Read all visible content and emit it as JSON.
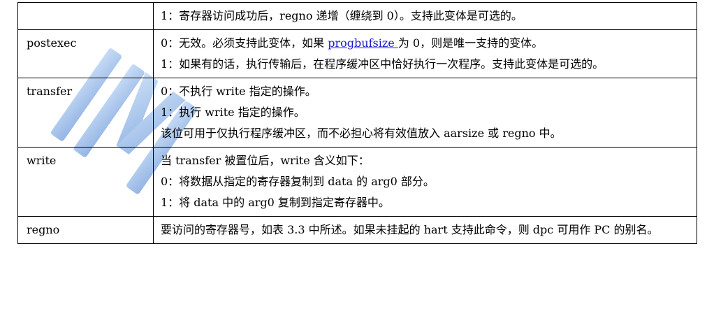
{
  "rows": [
    {
      "field": "",
      "lines": [
        "1：寄存器访问成功后，regno 递增（缠绕到 0）。支持此变体是可选的。"
      ]
    },
    {
      "field": "postexec",
      "line1_prefix": "0：无效。必须支持此变体，如果 ",
      "line1_link": "progbufsize ",
      "line1_suffix": "为 0，则是唯一支持的变体。",
      "line2": "1：如果有的话，执行传输后，在程序缓冲区中恰好执行一次程序。支持此变体是可选的。"
    },
    {
      "field": "transfer",
      "lines": [
        "0：不执行 write 指定的操作。",
        "1：执行 write 指定的操作。",
        "该位可用于仅执行程序缓冲区，而不必担心将有效值放入 aarsize 或 regno 中。"
      ]
    },
    {
      "field": "write",
      "lines": [
        "当 transfer 被置位后，write 含义如下：",
        "0：将数据从指定的寄存器复制到 data 的 arg0 部分。",
        "1：将 data 中的 arg0 复制到指定寄存器中。"
      ]
    },
    {
      "field": "regno",
      "lines": [
        "要访问的寄存器号，如表 3.3 中所述。如果未挂起的 hart 支持此命令，则 dpc 可用作 PC 的别名。"
      ]
    }
  ],
  "colors": {
    "link": "#1a1acc",
    "watermark": "#5a8fd8"
  }
}
